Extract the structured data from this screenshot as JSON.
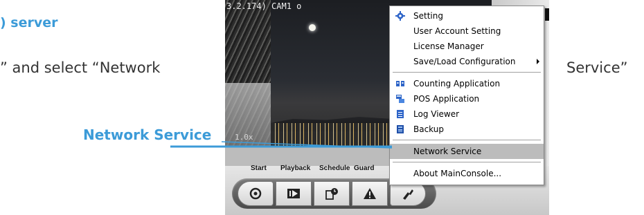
{
  "document": {
    "heading": ") server",
    "text_left": "” and select “Network",
    "text_right": "Service”",
    "callout_label": "Network Service"
  },
  "camera": {
    "title": "3.2.174)   CAM1 o",
    "zoom": "1.0x"
  },
  "command_labels": {
    "start": "Start",
    "playback": "Playback",
    "schedule": "Schedule",
    "guard": "Guard"
  },
  "toolbar_icons": [
    "start-icon",
    "playback-icon",
    "schedule-icon",
    "guard-icon",
    "tools-icon"
  ],
  "context_menu": {
    "items": [
      {
        "label": "Setting",
        "icon": "gear-icon"
      },
      {
        "label": "User Account Setting",
        "icon": ""
      },
      {
        "label": "License Manager",
        "icon": ""
      },
      {
        "label": "Save/Load Configuration",
        "icon": "",
        "submenu": true
      },
      {
        "label": "Counting Application",
        "icon": "counting-icon"
      },
      {
        "label": "POS Application",
        "icon": "pos-icon"
      },
      {
        "label": "Log Viewer",
        "icon": "log-icon"
      },
      {
        "label": "Backup",
        "icon": "backup-icon"
      },
      {
        "label": "Network Service",
        "icon": "",
        "highlighted": true
      },
      {
        "label": "About MainConsole...",
        "icon": ""
      }
    ]
  },
  "colors": {
    "accent": "#3c9bd8",
    "menu_highlight": "#bcbcbc"
  }
}
